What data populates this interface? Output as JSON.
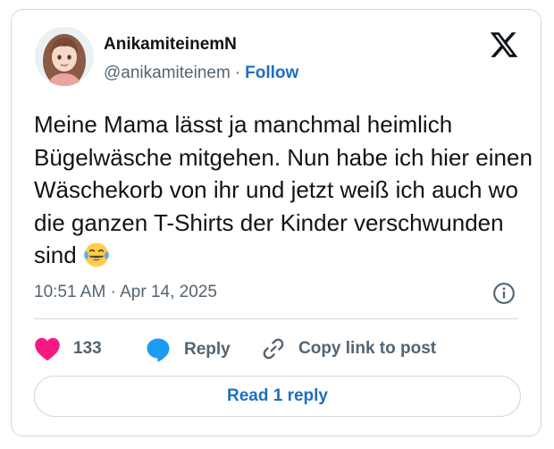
{
  "tweet": {
    "author": {
      "display_name": "AnikamiteinemN",
      "handle": "@anikamiteinem",
      "separator": "·",
      "follow_label": "Follow"
    },
    "text": "Meine Mama lässt ja manchmal heimlich Bügelwäsche mitgehen. Nun habe ich hier einen Wäschekorb von ihr und jetzt weiß ich auch wo die ganzen T-Shirts der Kinder verschwunden sind",
    "emoji": "face-with-tears-of-joy",
    "timestamp": "10:51 AM · Apr 14, 2025",
    "actions": {
      "likes_count": "133",
      "reply_label": "Reply",
      "copy_label": "Copy link to post"
    },
    "read_replies_label": "Read 1 reply"
  },
  "icons": {
    "brand_logo": "x-logo-icon",
    "info": "info-icon",
    "like": "heart-icon",
    "reply": "speech-bubble-icon",
    "copy": "link-icon"
  },
  "colors": {
    "link_blue": "#1d6fc4",
    "heart_pink": "#f91880",
    "secondary_text": "#536471",
    "border": "#cfd9de"
  }
}
